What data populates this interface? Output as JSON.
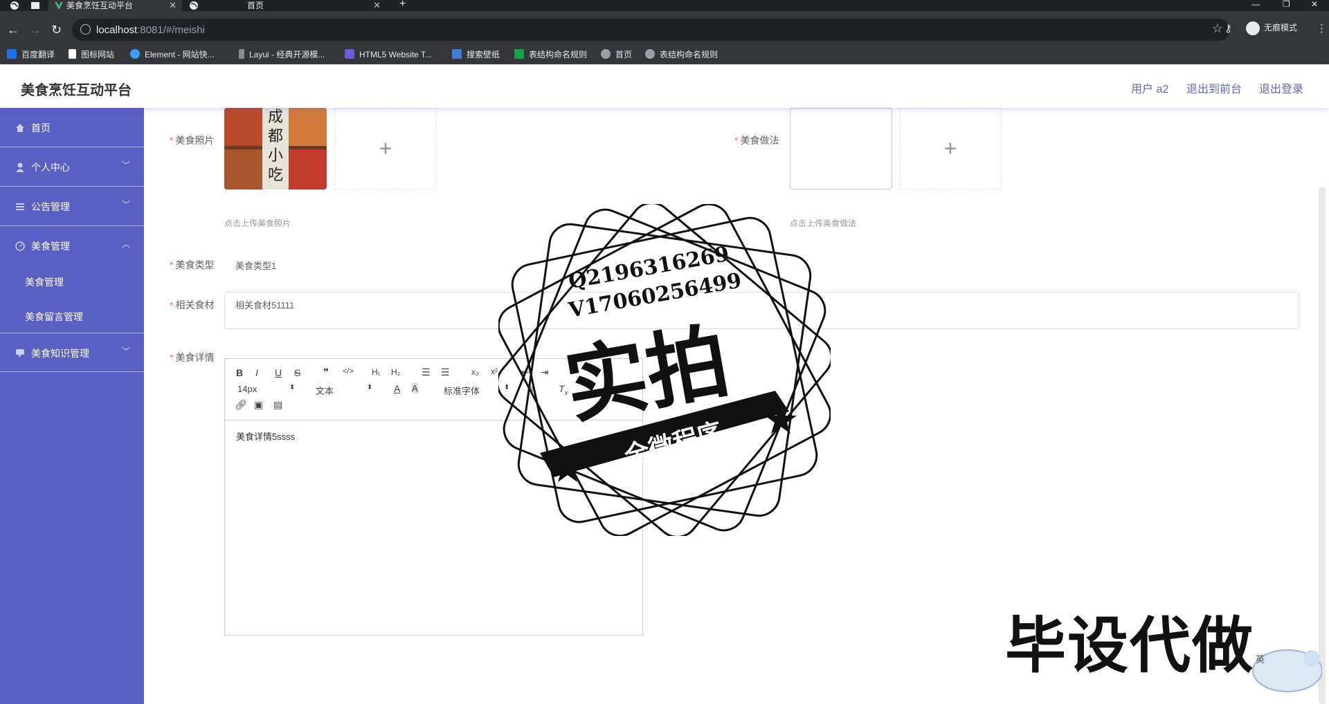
{
  "browser": {
    "tabs": [
      {
        "title": "美食烹饪互动平台"
      },
      {
        "title": "首页"
      }
    ],
    "new_tab": "+",
    "url_host": "localhost",
    "url_rest": ":8081/#/meishi",
    "profile_label": "无痕模式",
    "bookmarks": [
      {
        "label": "百度翻译",
        "color": "#1e6fe8"
      },
      {
        "label": "图标网站",
        "color": "#ffffff"
      },
      {
        "label": "Element - 网站快...",
        "color": "#409eff"
      },
      {
        "label": "Layui - 经典开源模...",
        "color": "#8a8a8a"
      },
      {
        "label": "HTML5 Website T...",
        "color": "#6b5cd6"
      },
      {
        "label": "搜索壁纸",
        "color": "#3f7dd6"
      },
      {
        "label": "表结构命名规则",
        "color": "#16a34a"
      },
      {
        "label": "首页",
        "color": "#9aa0a6"
      },
      {
        "label": "表结构命名规则",
        "color": "#9aa0a6"
      }
    ]
  },
  "header": {
    "title": "美食烹饪互动平台",
    "user": "用户 a2",
    "back_front": "退出到前台",
    "logout": "退出登录"
  },
  "sidebar": {
    "items": [
      {
        "label": "首页"
      },
      {
        "label": "个人中心"
      },
      {
        "label": "公告管理"
      },
      {
        "label": "美食管理"
      },
      {
        "label": "美食知识管理"
      }
    ],
    "subitems": [
      {
        "label": "美食管理"
      },
      {
        "label": "美食留言管理"
      }
    ]
  },
  "form": {
    "photo_label": "美食照片",
    "photo_hint": "点击上传美食照片",
    "method_label": "美食做法",
    "method_hint": "点击上传美食做法",
    "type_label": "美食类型",
    "type_value": "美食类型1",
    "ingredients_label": "相关食材",
    "ingredients_value": "相关食材51111",
    "detail_label": "美食详情",
    "detail_value": "美食详情5ssss",
    "font_size": "14px",
    "text_style": "文本",
    "font_family": "标准字体",
    "photo_text": "成都小吃"
  },
  "watermark": {
    "line1": "Q2196316269",
    "line2": "V17060256499",
    "big": "实拍",
    "ribbon": "全微程序",
    "bottom": "毕设代做",
    "ime": "英"
  },
  "colors": {
    "sidebar": "#5a5fc3",
    "accent": "#5c6ab8",
    "required": "#f56c6c"
  }
}
